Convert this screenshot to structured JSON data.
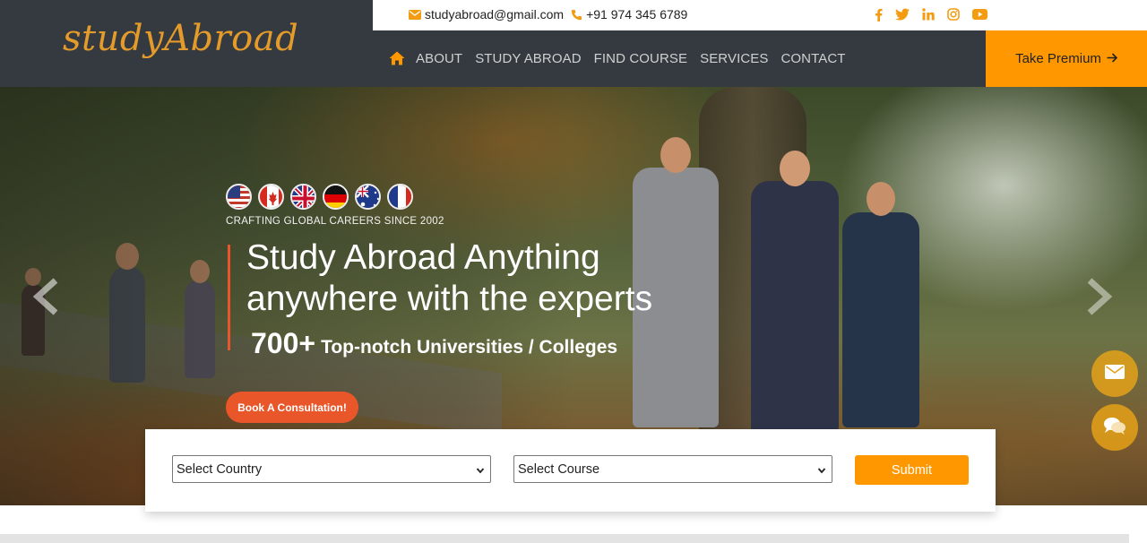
{
  "brand": {
    "logo": "studyAbroad"
  },
  "topbar": {
    "email": "studyabroad@gmail.com",
    "phone": "+91 974 345 6789",
    "socials": [
      "facebook-icon",
      "twitter-icon",
      "linkedin-icon",
      "instagram-icon",
      "youtube-icon"
    ]
  },
  "nav": {
    "items": [
      "ABOUT",
      "STUDY ABROAD",
      "FIND COURSE",
      "SERVICES",
      "CONTACT"
    ],
    "premium_label": "Take Premium"
  },
  "hero": {
    "flags": [
      "USA",
      "Canada",
      "UK",
      "Germany",
      "Australia",
      "France"
    ],
    "tagline": "CRAFTING GLOBAL CAREERS SINCE 2002",
    "headline_line1": "Study Abroad Anything",
    "headline_line2": "anywhere with the experts",
    "stat_number": "700+",
    "stat_text": "Top-notch Universities / Colleges",
    "cta_label": "Book A Consultation!"
  },
  "search": {
    "country_value": "Select Country",
    "course_value": "Select Course",
    "submit_label": "Submit"
  },
  "colors": {
    "accent": "#ff9800",
    "dark": "#343a40",
    "cta": "#e8562a",
    "logo": "#e59b2a"
  }
}
